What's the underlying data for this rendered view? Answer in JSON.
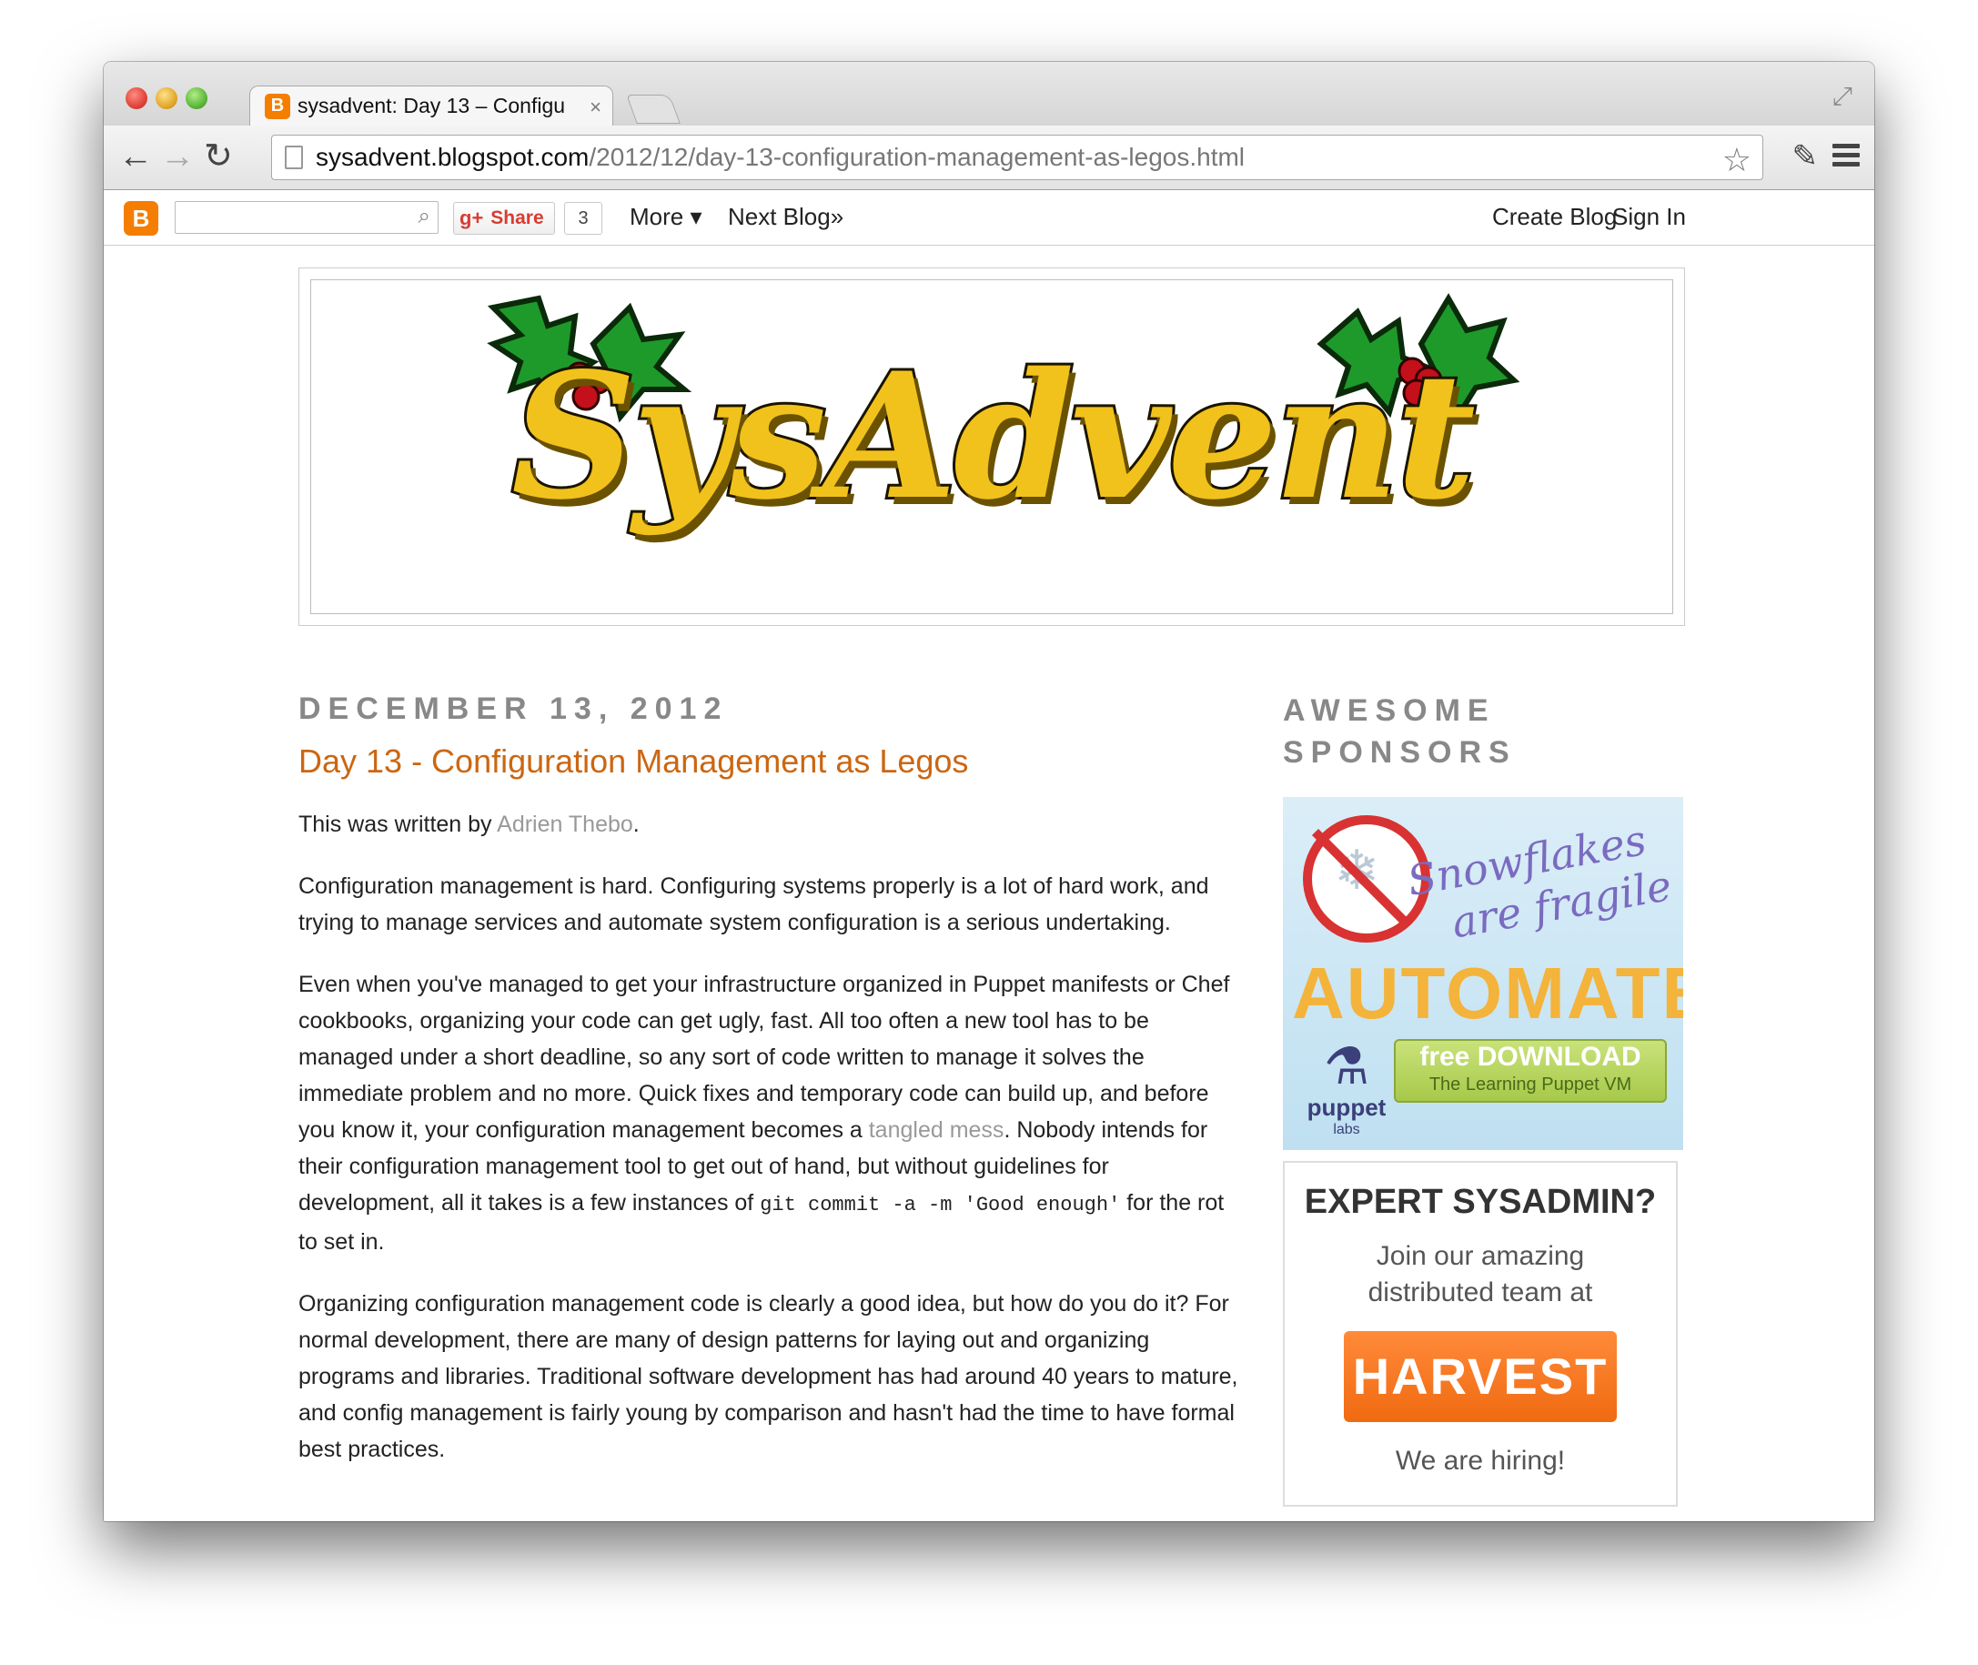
{
  "browser": {
    "tab_title": "sysadvent: Day 13 – Configu",
    "url_host": "sysadvent.blogspot.com",
    "url_path": "/2012/12/day-13-configuration-management-as-legos.html"
  },
  "navbar": {
    "share_label": "Share",
    "share_count": "3",
    "more_label": "More ▾",
    "next_blog_label": "Next Blog»",
    "create_blog_label": "Create Blog",
    "sign_in_label": "Sign In"
  },
  "header": {
    "logo_text": "SysAdvent"
  },
  "post": {
    "date": "DECEMBER 13, 2012",
    "title": "Day 13 - Configuration Management as Legos",
    "p1_prefix": "This was written by ",
    "p1_author": "Adrien Thebo",
    "p1_suffix": ".",
    "p2": "Configuration management is hard. Configuring systems properly is a lot of hard work, and trying to manage services and automate system configuration is a serious undertaking.",
    "p3_a": "Even when you've managed to get your infrastructure organized in Puppet manifests or Chef cookbooks, organizing your code can get ugly, fast. All too often a new tool has to be managed under a short deadline, so any sort of code written to manage it solves the immediate problem and no more. Quick fixes and temporary code can build up, and before you know it, your configuration management becomes a ",
    "p3_link": "tangled mess",
    "p3_b": ". Nobody intends for their configuration management tool to get out of hand, but without guidelines for development, all it takes is a few instances of ",
    "p3_code": "git commit -a -m 'Good enough'",
    "p3_c": " for the rot to set in.",
    "p4": "Organizing configuration management code is clearly a good idea, but how do you do it? For normal development, there are many of design patterns for laying out and organizing programs and libraries. Traditional software development has had around 40 years to mature, and config management is fairly young by comparison and hasn't had the time to have formal best practices."
  },
  "sidebar": {
    "title": "AWESOME SPONSORS",
    "ad1": {
      "script_line1": "Snowflakes",
      "script_line2": "are fragile",
      "headline": "AUTOMATE",
      "brand": "puppet",
      "brand_sub": "labs",
      "dl_top": "free DOWNLOAD",
      "dl_bottom": "The Learning Puppet VM"
    },
    "ad2": {
      "title": "EXPERT SYSADMIN?",
      "text_line1": "Join our amazing",
      "text_line2": "distributed team at",
      "button": "HARVEST",
      "footer": "We are hiring!"
    }
  },
  "colors": {
    "title_orange": "#cc6611",
    "blogger_orange": "#f57d00",
    "harvest_orange": "#f06a10"
  }
}
